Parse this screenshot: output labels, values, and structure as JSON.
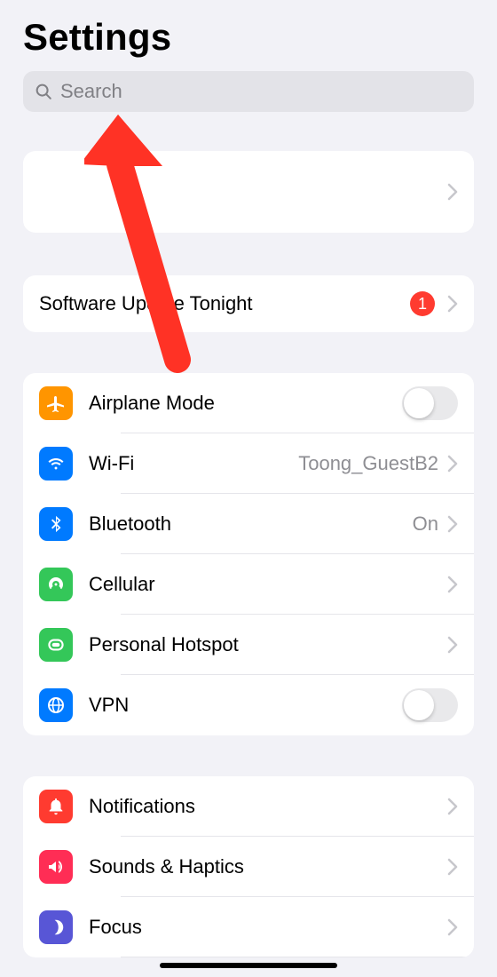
{
  "header": {
    "title": "Settings"
  },
  "search": {
    "placeholder": "Search"
  },
  "update": {
    "label": "Software Update Tonight",
    "badge": "1"
  },
  "connectivity": {
    "airplane": {
      "label": "Airplane Mode"
    },
    "wifi": {
      "label": "Wi-Fi",
      "value": "Toong_GuestB2"
    },
    "bluetooth": {
      "label": "Bluetooth",
      "value": "On"
    },
    "cellular": {
      "label": "Cellular"
    },
    "hotspot": {
      "label": "Personal Hotspot"
    },
    "vpn": {
      "label": "VPN"
    }
  },
  "system": {
    "notifications": {
      "label": "Notifications"
    },
    "sounds": {
      "label": "Sounds & Haptics"
    },
    "focus": {
      "label": "Focus"
    }
  },
  "colors": {
    "orange": "#ff9500",
    "blue": "#007aff",
    "green": "#34c759",
    "red": "#ff3b30",
    "pink": "#ff2d55",
    "indigo": "#5856d6"
  }
}
